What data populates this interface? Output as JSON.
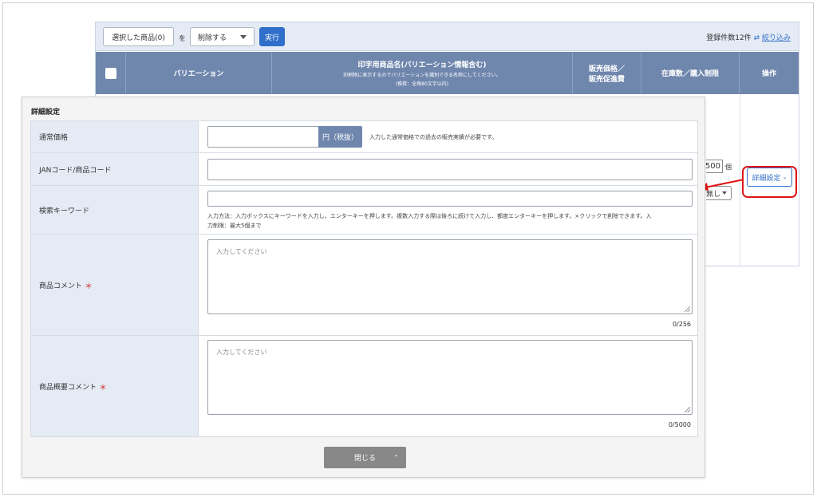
{
  "toolbar": {
    "selected_items_label": "選択した商品(0)",
    "wo_label": "を",
    "action_select": "削除する",
    "run_label": "実行",
    "count_text": "登録件数12件",
    "filter_link": "絞り込み"
  },
  "table_header": {
    "variation": "バリエーション",
    "print_name": "印字用商品名(バリエーション情報含む)",
    "print_name_note1": "印刷物に表示するのでバリエーションを識別できる名称にしてください。",
    "print_name_note2": "(推奨：全角80文字以内)",
    "price_line1": "販売価格／",
    "price_line2": "販売促進費",
    "stock": "在庫数／購入制限",
    "operation": "操作"
  },
  "row": {
    "stock_value": "500",
    "stock_unit": "個",
    "limit_value": "無し",
    "detail_button": "詳細設定"
  },
  "modal": {
    "title": "詳細設定",
    "price": {
      "label": "通常価格",
      "unit_button": "円（税抜）",
      "hint": "入力した通常価格での過去の販売実績が必要です。"
    },
    "jan": {
      "label": "JANコード/商品コード"
    },
    "keyword": {
      "label": "検索キーワード",
      "hint_line1": "入力方法：入力ボックスにキーワードを入力し、エンターキーを押します。複数入力する際は後ろに続けて入力し、都度エンターキーを押します。×クリックで削除できます。入",
      "hint_line2": "力制限：最大5個まで"
    },
    "short_comment": {
      "label": "商品コメント",
      "required": "＊",
      "placeholder": "入力してください",
      "counter": "0/256"
    },
    "overview_comment": {
      "label": "商品概要コメント",
      "required": "＊",
      "placeholder": "入力してください",
      "counter": "0/5000"
    },
    "close_button": "閉じる"
  },
  "colors": {
    "header_bg": "#6f86ad",
    "label_bg": "#e4ebf5",
    "primary": "#2f6fc9",
    "highlight": "#e01515"
  }
}
